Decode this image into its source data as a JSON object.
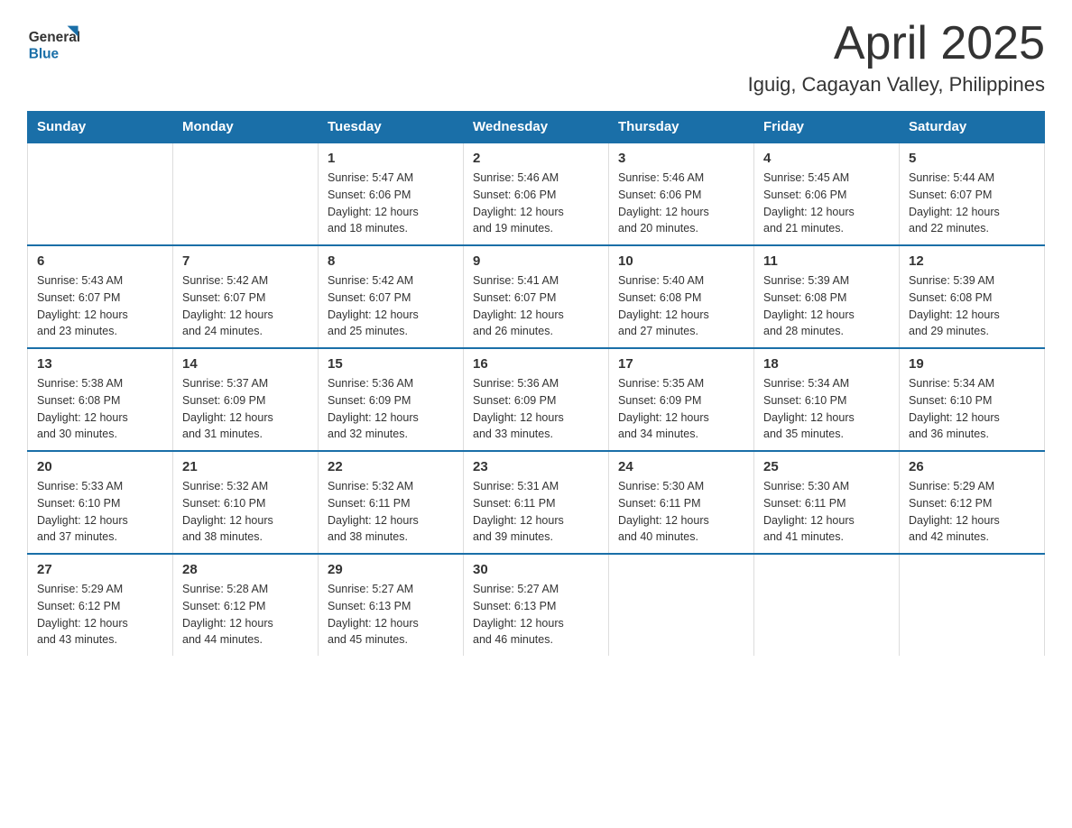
{
  "header": {
    "logo_general": "General",
    "logo_blue": "Blue",
    "title": "April 2025",
    "subtitle": "Iguig, Cagayan Valley, Philippines"
  },
  "columns": [
    "Sunday",
    "Monday",
    "Tuesday",
    "Wednesday",
    "Thursday",
    "Friday",
    "Saturday"
  ],
  "weeks": [
    [
      {
        "day": "",
        "info": ""
      },
      {
        "day": "",
        "info": ""
      },
      {
        "day": "1",
        "info": "Sunrise: 5:47 AM\nSunset: 6:06 PM\nDaylight: 12 hours\nand 18 minutes."
      },
      {
        "day": "2",
        "info": "Sunrise: 5:46 AM\nSunset: 6:06 PM\nDaylight: 12 hours\nand 19 minutes."
      },
      {
        "day": "3",
        "info": "Sunrise: 5:46 AM\nSunset: 6:06 PM\nDaylight: 12 hours\nand 20 minutes."
      },
      {
        "day": "4",
        "info": "Sunrise: 5:45 AM\nSunset: 6:06 PM\nDaylight: 12 hours\nand 21 minutes."
      },
      {
        "day": "5",
        "info": "Sunrise: 5:44 AM\nSunset: 6:07 PM\nDaylight: 12 hours\nand 22 minutes."
      }
    ],
    [
      {
        "day": "6",
        "info": "Sunrise: 5:43 AM\nSunset: 6:07 PM\nDaylight: 12 hours\nand 23 minutes."
      },
      {
        "day": "7",
        "info": "Sunrise: 5:42 AM\nSunset: 6:07 PM\nDaylight: 12 hours\nand 24 minutes."
      },
      {
        "day": "8",
        "info": "Sunrise: 5:42 AM\nSunset: 6:07 PM\nDaylight: 12 hours\nand 25 minutes."
      },
      {
        "day": "9",
        "info": "Sunrise: 5:41 AM\nSunset: 6:07 PM\nDaylight: 12 hours\nand 26 minutes."
      },
      {
        "day": "10",
        "info": "Sunrise: 5:40 AM\nSunset: 6:08 PM\nDaylight: 12 hours\nand 27 minutes."
      },
      {
        "day": "11",
        "info": "Sunrise: 5:39 AM\nSunset: 6:08 PM\nDaylight: 12 hours\nand 28 minutes."
      },
      {
        "day": "12",
        "info": "Sunrise: 5:39 AM\nSunset: 6:08 PM\nDaylight: 12 hours\nand 29 minutes."
      }
    ],
    [
      {
        "day": "13",
        "info": "Sunrise: 5:38 AM\nSunset: 6:08 PM\nDaylight: 12 hours\nand 30 minutes."
      },
      {
        "day": "14",
        "info": "Sunrise: 5:37 AM\nSunset: 6:09 PM\nDaylight: 12 hours\nand 31 minutes."
      },
      {
        "day": "15",
        "info": "Sunrise: 5:36 AM\nSunset: 6:09 PM\nDaylight: 12 hours\nand 32 minutes."
      },
      {
        "day": "16",
        "info": "Sunrise: 5:36 AM\nSunset: 6:09 PM\nDaylight: 12 hours\nand 33 minutes."
      },
      {
        "day": "17",
        "info": "Sunrise: 5:35 AM\nSunset: 6:09 PM\nDaylight: 12 hours\nand 34 minutes."
      },
      {
        "day": "18",
        "info": "Sunrise: 5:34 AM\nSunset: 6:10 PM\nDaylight: 12 hours\nand 35 minutes."
      },
      {
        "day": "19",
        "info": "Sunrise: 5:34 AM\nSunset: 6:10 PM\nDaylight: 12 hours\nand 36 minutes."
      }
    ],
    [
      {
        "day": "20",
        "info": "Sunrise: 5:33 AM\nSunset: 6:10 PM\nDaylight: 12 hours\nand 37 minutes."
      },
      {
        "day": "21",
        "info": "Sunrise: 5:32 AM\nSunset: 6:10 PM\nDaylight: 12 hours\nand 38 minutes."
      },
      {
        "day": "22",
        "info": "Sunrise: 5:32 AM\nSunset: 6:11 PM\nDaylight: 12 hours\nand 38 minutes."
      },
      {
        "day": "23",
        "info": "Sunrise: 5:31 AM\nSunset: 6:11 PM\nDaylight: 12 hours\nand 39 minutes."
      },
      {
        "day": "24",
        "info": "Sunrise: 5:30 AM\nSunset: 6:11 PM\nDaylight: 12 hours\nand 40 minutes."
      },
      {
        "day": "25",
        "info": "Sunrise: 5:30 AM\nSunset: 6:11 PM\nDaylight: 12 hours\nand 41 minutes."
      },
      {
        "day": "26",
        "info": "Sunrise: 5:29 AM\nSunset: 6:12 PM\nDaylight: 12 hours\nand 42 minutes."
      }
    ],
    [
      {
        "day": "27",
        "info": "Sunrise: 5:29 AM\nSunset: 6:12 PM\nDaylight: 12 hours\nand 43 minutes."
      },
      {
        "day": "28",
        "info": "Sunrise: 5:28 AM\nSunset: 6:12 PM\nDaylight: 12 hours\nand 44 minutes."
      },
      {
        "day": "29",
        "info": "Sunrise: 5:27 AM\nSunset: 6:13 PM\nDaylight: 12 hours\nand 45 minutes."
      },
      {
        "day": "30",
        "info": "Sunrise: 5:27 AM\nSunset: 6:13 PM\nDaylight: 12 hours\nand 46 minutes."
      },
      {
        "day": "",
        "info": ""
      },
      {
        "day": "",
        "info": ""
      },
      {
        "day": "",
        "info": ""
      }
    ]
  ]
}
